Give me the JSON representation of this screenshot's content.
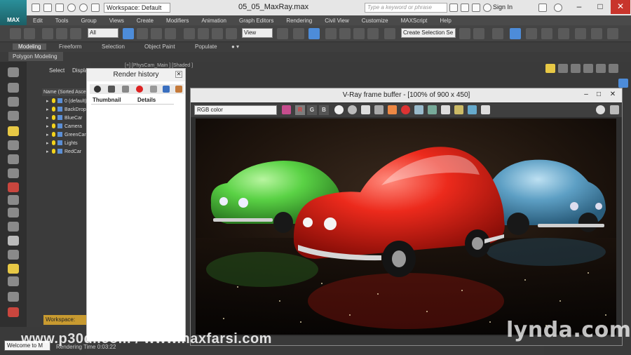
{
  "app": {
    "logo_text": "MAX",
    "workspace": "Workspace: Default",
    "file_title": "05_05_MaxRay.max",
    "search_placeholder": "Type a keyword or phrase",
    "sign_in": "Sign In"
  },
  "menu": [
    "Edit",
    "Tools",
    "Group",
    "Views",
    "Create",
    "Modifiers",
    "Animation",
    "Graph Editors",
    "Rendering",
    "Civil View",
    "Customize",
    "MAXScript",
    "Help"
  ],
  "toolbar": {
    "filter_value": "All",
    "ref_coord_value": "View",
    "selection_set_placeholder": "Create Selection Se"
  },
  "ribbon": {
    "tabs": [
      "Modeling",
      "Freeform",
      "Selection",
      "Object Paint",
      "Populate"
    ],
    "active_tab": "Modeling",
    "subtab": "Polygon Modeling"
  },
  "explorer": {
    "tabs": [
      "Select",
      "Display"
    ],
    "column_header": "Name (Sorted Ascending)",
    "items": [
      {
        "label": "0 (default)"
      },
      {
        "label": "BackDrop"
      },
      {
        "label": "BlueCar"
      },
      {
        "label": "Camera"
      },
      {
        "label": "GreenCar"
      },
      {
        "label": "Lights"
      },
      {
        "label": "RedCar"
      }
    ],
    "workspace_label": "Workspace: Default"
  },
  "render_history": {
    "title": "Render history",
    "col_thumbnail": "Thumbnail",
    "col_details": "Details"
  },
  "viewport": {
    "label": "[+] [PhysCam_Main ] [Shaded ]"
  },
  "vfb": {
    "title": "V-Ray frame buffer - [100% of 900 x 450]",
    "channel_select": "RGB color",
    "channels": [
      "R",
      "G",
      "B"
    ]
  },
  "status": {
    "welcome": "Welcome to M",
    "render_time": "Rendering Time  0:03:22"
  },
  "watermarks": {
    "left": "www.p30dl.com / www.naxfarsi.com",
    "right": "lynda.com"
  },
  "colors": {
    "red_car": "#e8231b",
    "green_car": "#58d245",
    "blue_car": "#5d9fc4",
    "status_bar_workspace": "#c89a30",
    "selection_blue": "#4d8cd9"
  }
}
